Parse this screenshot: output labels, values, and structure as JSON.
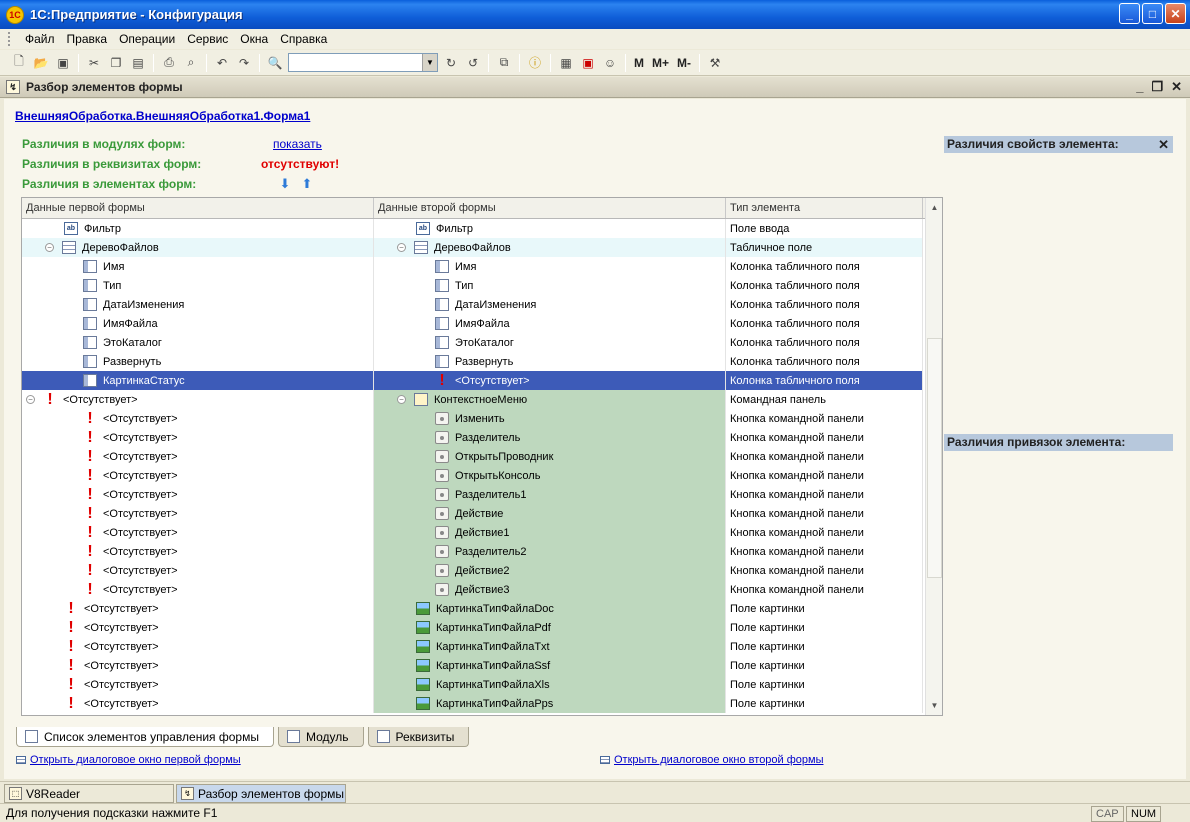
{
  "window": {
    "title": "1С:Предприятие - Конфигурация"
  },
  "menu": [
    "Файл",
    "Правка",
    "Операции",
    "Сервис",
    "Окна",
    "Справка"
  ],
  "toolbar": {
    "search_value": "",
    "m_labels": [
      "M",
      "M+",
      "M-"
    ]
  },
  "document": {
    "title": "Разбор элементов формы"
  },
  "form": {
    "link": "ВнешняяОбработка.ВнешняяОбработка1.Форма1",
    "diff_modules_label": "Различия в модулях форм:",
    "diff_modules_value": "показать",
    "diff_attrs_label": "Различия в реквизитах форм:",
    "diff_attrs_value": "отсутствуют!",
    "diff_elements_label": "Различия в элементах форм:"
  },
  "grid": {
    "columns": [
      "Данные первой формы",
      "Данные второй формы",
      "Тип элемента"
    ],
    "rows": [
      {
        "indent1": 2,
        "icon1": "field",
        "text1": "Фильтр",
        "indent2": 2,
        "icon2": "field",
        "text2": "Фильтр",
        "type": "Поле ввода",
        "style": "",
        "green": false
      },
      {
        "indent1": 1,
        "exp1": true,
        "icon1": "table",
        "text1": "ДеревоФайлов",
        "indent2": 1,
        "exp2": true,
        "icon2": "table",
        "text2": "ДеревоФайлов",
        "type": "Табличное поле",
        "style": "light",
        "green": false
      },
      {
        "indent1": 3,
        "icon1": "col",
        "text1": "Имя",
        "indent2": 3,
        "icon2": "col",
        "text2": "Имя",
        "type": "Колонка табличного поля",
        "style": "",
        "green": false
      },
      {
        "indent1": 3,
        "icon1": "col",
        "text1": "Тип",
        "indent2": 3,
        "icon2": "col",
        "text2": "Тип",
        "type": "Колонка табличного поля",
        "style": "",
        "green": false
      },
      {
        "indent1": 3,
        "icon1": "col",
        "text1": "ДатаИзменения",
        "indent2": 3,
        "icon2": "col",
        "text2": "ДатаИзменения",
        "type": "Колонка табличного поля",
        "style": "",
        "green": false
      },
      {
        "indent1": 3,
        "icon1": "col",
        "text1": "ИмяФайла",
        "indent2": 3,
        "icon2": "col",
        "text2": "ИмяФайла",
        "type": "Колонка табличного поля",
        "style": "",
        "green": false
      },
      {
        "indent1": 3,
        "icon1": "col",
        "text1": "ЭтоКаталог",
        "indent2": 3,
        "icon2": "col",
        "text2": "ЭтоКаталог",
        "type": "Колонка табличного поля",
        "style": "",
        "green": false
      },
      {
        "indent1": 3,
        "icon1": "col",
        "text1": "Развернуть",
        "indent2": 3,
        "icon2": "col",
        "text2": "Развернуть",
        "type": "Колонка табличного поля",
        "style": "",
        "green": false
      },
      {
        "indent1": 3,
        "icon1": "col",
        "text1": "КартинкаСтатус",
        "indent2": 3,
        "icon2": "bang",
        "text2": "<Отсутствует>",
        "type": "Колонка табличного поля",
        "style": "sel",
        "green": false
      },
      {
        "indent1": 0,
        "exp1": true,
        "icon1": "bang",
        "text1": "<Отсутствует>",
        "indent2": 1,
        "exp2": true,
        "icon2": "panel",
        "text2": "КонтекстноеМеню",
        "type": "Командная панель",
        "style": "",
        "green": true
      },
      {
        "indent1": 3,
        "icon1": "bang",
        "text1": "<Отсутствует>",
        "indent2": 3,
        "icon2": "btn",
        "text2": "Изменить",
        "type": "Кнопка командной панели",
        "style": "",
        "green": true
      },
      {
        "indent1": 3,
        "icon1": "bang",
        "text1": "<Отсутствует>",
        "indent2": 3,
        "icon2": "btn",
        "text2": "Разделитель",
        "type": "Кнопка командной панели",
        "style": "",
        "green": true
      },
      {
        "indent1": 3,
        "icon1": "bang",
        "text1": "<Отсутствует>",
        "indent2": 3,
        "icon2": "btn",
        "text2": "ОткрытьПроводник",
        "type": "Кнопка командной панели",
        "style": "",
        "green": true
      },
      {
        "indent1": 3,
        "icon1": "bang",
        "text1": "<Отсутствует>",
        "indent2": 3,
        "icon2": "btn",
        "text2": "ОткрытьКонсоль",
        "type": "Кнопка командной панели",
        "style": "",
        "green": true
      },
      {
        "indent1": 3,
        "icon1": "bang",
        "text1": "<Отсутствует>",
        "indent2": 3,
        "icon2": "btn",
        "text2": "Разделитель1",
        "type": "Кнопка командной панели",
        "style": "",
        "green": true
      },
      {
        "indent1": 3,
        "icon1": "bang",
        "text1": "<Отсутствует>",
        "indent2": 3,
        "icon2": "btn",
        "text2": "Действие",
        "type": "Кнопка командной панели",
        "style": "",
        "green": true
      },
      {
        "indent1": 3,
        "icon1": "bang",
        "text1": "<Отсутствует>",
        "indent2": 3,
        "icon2": "btn",
        "text2": "Действие1",
        "type": "Кнопка командной панели",
        "style": "",
        "green": true
      },
      {
        "indent1": 3,
        "icon1": "bang",
        "text1": "<Отсутствует>",
        "indent2": 3,
        "icon2": "btn",
        "text2": "Разделитель2",
        "type": "Кнопка командной панели",
        "style": "",
        "green": true
      },
      {
        "indent1": 3,
        "icon1": "bang",
        "text1": "<Отсутствует>",
        "indent2": 3,
        "icon2": "btn",
        "text2": "Действие2",
        "type": "Кнопка командной панели",
        "style": "",
        "green": true
      },
      {
        "indent1": 3,
        "icon1": "bang",
        "text1": "<Отсутствует>",
        "indent2": 3,
        "icon2": "btn",
        "text2": "Действие3",
        "type": "Кнопка командной панели",
        "style": "",
        "green": true
      },
      {
        "indent1": 2,
        "icon1": "bang",
        "text1": "<Отсутствует>",
        "indent2": 2,
        "icon2": "pic",
        "text2": "КартинкаТипФайлаDoc",
        "type": "Поле картинки",
        "style": "",
        "green": true
      },
      {
        "indent1": 2,
        "icon1": "bang",
        "text1": "<Отсутствует>",
        "indent2": 2,
        "icon2": "pic",
        "text2": "КартинкаТипФайлаPdf",
        "type": "Поле картинки",
        "style": "",
        "green": true
      },
      {
        "indent1": 2,
        "icon1": "bang",
        "text1": "<Отсутствует>",
        "indent2": 2,
        "icon2": "pic",
        "text2": "КартинкаТипФайлаTxt",
        "type": "Поле картинки",
        "style": "",
        "green": true
      },
      {
        "indent1": 2,
        "icon1": "bang",
        "text1": "<Отсутствует>",
        "indent2": 2,
        "icon2": "pic",
        "text2": "КартинкаТипФайлаSsf",
        "type": "Поле картинки",
        "style": "",
        "green": true
      },
      {
        "indent1": 2,
        "icon1": "bang",
        "text1": "<Отсутствует>",
        "indent2": 2,
        "icon2": "pic",
        "text2": "КартинкаТипФайлаXls",
        "type": "Поле картинки",
        "style": "",
        "green": true
      },
      {
        "indent1": 2,
        "icon1": "bang",
        "text1": "<Отсутствует>",
        "indent2": 2,
        "icon2": "pic",
        "text2": "КартинкаТипФайлаPps",
        "type": "Поле картинки",
        "style": "",
        "green": true
      }
    ]
  },
  "side": {
    "props_title": "Различия свойств элемента:",
    "bindings_title": "Различия привязок элемента:"
  },
  "tabs": [
    "Список элементов управления формы",
    "Модуль",
    "Реквизиты"
  ],
  "links": {
    "open_first": "Открыть диалоговое окно первой формы",
    "open_second": "Открыть диалоговое окно второй формы"
  },
  "window_tabs": [
    "V8Reader",
    "Разбор элементов формы"
  ],
  "status": {
    "hint": "Для получения подсказки нажмите F1",
    "cap": "CAP",
    "num": "NUM"
  },
  "colors": {
    "green_cell": "#BED8BE",
    "selection": "#3D5BB8",
    "missing": "#E00000",
    "label_green": "#3A9A3A"
  }
}
